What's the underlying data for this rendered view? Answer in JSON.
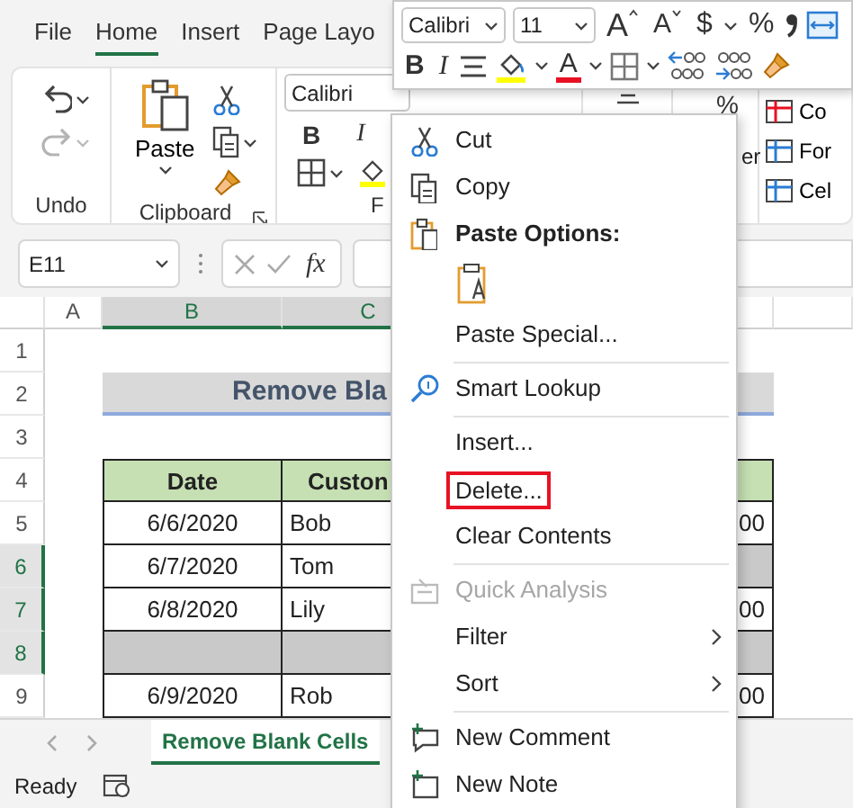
{
  "ribbon_tabs": [
    {
      "label": "File",
      "selected": false
    },
    {
      "label": "Home",
      "selected": true
    },
    {
      "label": "Insert",
      "selected": false
    },
    {
      "label": "Page Layo",
      "selected": false
    }
  ],
  "ribbon": {
    "undo_group": {
      "label": "Undo"
    },
    "clipboard_group": {
      "label": "Clipboard",
      "paste_label": "Paste"
    },
    "font_group": {
      "font_name": "Calibri",
      "bold": "B",
      "italic": "I",
      "label": "F"
    },
    "number_group": {
      "symbol": "%",
      "label": "er"
    },
    "styles_group": {
      "items": [
        "Co",
        "For",
        "Cel"
      ]
    }
  },
  "formula_bar": {
    "name_box": "E11",
    "function_label": "fx"
  },
  "sheet": {
    "columns": [
      {
        "label": "A",
        "selected": false
      },
      {
        "label": "B",
        "selected": true
      },
      {
        "label": "C",
        "selected": true
      }
    ],
    "rows": [
      {
        "number": "1",
        "selected": false,
        "kind": "empty"
      },
      {
        "number": "2",
        "selected": false,
        "kind": "title",
        "text": "Remove Bla"
      },
      {
        "number": "3",
        "selected": false,
        "kind": "empty"
      },
      {
        "number": "4",
        "selected": false,
        "kind": "header",
        "cells": [
          "Date",
          "Custon"
        ]
      },
      {
        "number": "5",
        "selected": false,
        "kind": "data",
        "cells": [
          {
            "text": "6/6/2020"
          },
          {
            "text": "Bob"
          },
          {
            "text": "00"
          }
        ]
      },
      {
        "number": "6",
        "selected": true,
        "kind": "data",
        "cells": [
          {
            "text": "6/7/2020"
          },
          {
            "text": "Tom"
          },
          {
            "blank": true
          }
        ]
      },
      {
        "number": "7",
        "selected": true,
        "kind": "data",
        "cells": [
          {
            "text": "6/8/2020"
          },
          {
            "text": "Lily"
          },
          {
            "text": "00"
          }
        ]
      },
      {
        "number": "8",
        "selected": true,
        "kind": "blank"
      },
      {
        "number": "9",
        "selected": false,
        "kind": "data",
        "cells": [
          {
            "text": "6/9/2020"
          },
          {
            "text": "Rob"
          },
          {
            "text": "00"
          }
        ]
      }
    ]
  },
  "sheet_tabs": [
    {
      "label": "Remove Blank Cells",
      "selected": true
    }
  ],
  "status_bar": {
    "text": "Ready"
  },
  "mini_toolbar": {
    "row_1": [
      {
        "kind": "combo",
        "value": "Calibri"
      },
      {
        "kind": "combo",
        "value": "11"
      },
      {
        "kind": "glyph",
        "label": "A"
      },
      {
        "kind": "glyph",
        "label": "A"
      },
      {
        "kind": "glyph",
        "label": "$"
      },
      {
        "kind": "caret"
      },
      {
        "kind": "glyph",
        "label": "%"
      },
      {
        "kind": "icon"
      },
      {
        "kind": "icon"
      }
    ],
    "row_2": [
      {
        "kind": "glyph",
        "label": "B"
      },
      {
        "kind": "glyph",
        "label": "I"
      },
      {
        "kind": "icon"
      },
      {
        "kind": "icon"
      },
      {
        "kind": "caret"
      },
      {
        "kind": "glyph",
        "label": "A"
      },
      {
        "kind": "caret"
      },
      {
        "kind": "icon"
      },
      {
        "kind": "caret"
      },
      {
        "kind": "icon"
      },
      {
        "kind": "icon"
      },
      {
        "kind": "icon"
      }
    ]
  },
  "context_menu": {
    "items": [
      {
        "kind": "command",
        "label": "Cut",
        "disabled": false,
        "submenu": false,
        "outlined": false
      },
      {
        "kind": "command",
        "label": "Copy",
        "disabled": false,
        "submenu": false,
        "outlined": false
      },
      {
        "kind": "heading",
        "label": "Paste Options:"
      },
      {
        "kind": "paste_icons"
      },
      {
        "kind": "command",
        "label": "Paste Special...",
        "disabled": false,
        "submenu": false,
        "outlined": false
      },
      {
        "kind": "separator"
      },
      {
        "kind": "command",
        "label": "Smart Lookup",
        "disabled": false,
        "submenu": false,
        "outlined": false
      },
      {
        "kind": "separator"
      },
      {
        "kind": "command",
        "label": "Insert...",
        "disabled": false,
        "submenu": false,
        "outlined": false
      },
      {
        "kind": "command",
        "label": "Delete...",
        "disabled": false,
        "submenu": false,
        "outlined": true
      },
      {
        "kind": "command",
        "label": "Clear Contents",
        "disabled": false,
        "submenu": false,
        "outlined": false
      },
      {
        "kind": "separator"
      },
      {
        "kind": "command",
        "label": "Quick Analysis",
        "disabled": true,
        "submenu": false,
        "outlined": false
      },
      {
        "kind": "command",
        "label": "Filter",
        "disabled": false,
        "submenu": true,
        "outlined": false
      },
      {
        "kind": "command",
        "label": "Sort",
        "disabled": false,
        "submenu": true,
        "outlined": false
      },
      {
        "kind": "separator"
      },
      {
        "kind": "command",
        "label": "New Comment",
        "disabled": false,
        "submenu": false,
        "outlined": false
      },
      {
        "kind": "command",
        "label": "New Note",
        "disabled": false,
        "submenu": false,
        "outlined": false
      }
    ]
  }
}
